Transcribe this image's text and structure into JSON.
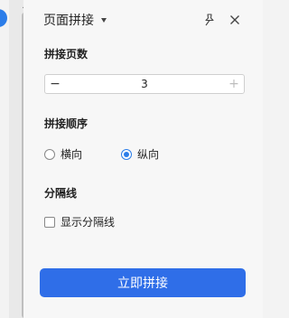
{
  "panel": {
    "title": "页面拼接",
    "pin_icon": "pin-icon",
    "close_icon": "close-icon"
  },
  "pages": {
    "label": "拼接页数",
    "value": "3",
    "minus": "−",
    "plus": "+"
  },
  "order": {
    "label": "拼接顺序",
    "options": [
      {
        "label": "横向",
        "checked": false
      },
      {
        "label": "纵向",
        "checked": true
      }
    ]
  },
  "divider": {
    "label": "分隔线",
    "checkbox_label": "显示分隔线",
    "checked": false
  },
  "action": {
    "button_label": "立即拼接"
  },
  "colors": {
    "accent": "#2f6ee8",
    "radio_selected": "#2b7de9",
    "panel_bg": "#f7f7f7"
  }
}
